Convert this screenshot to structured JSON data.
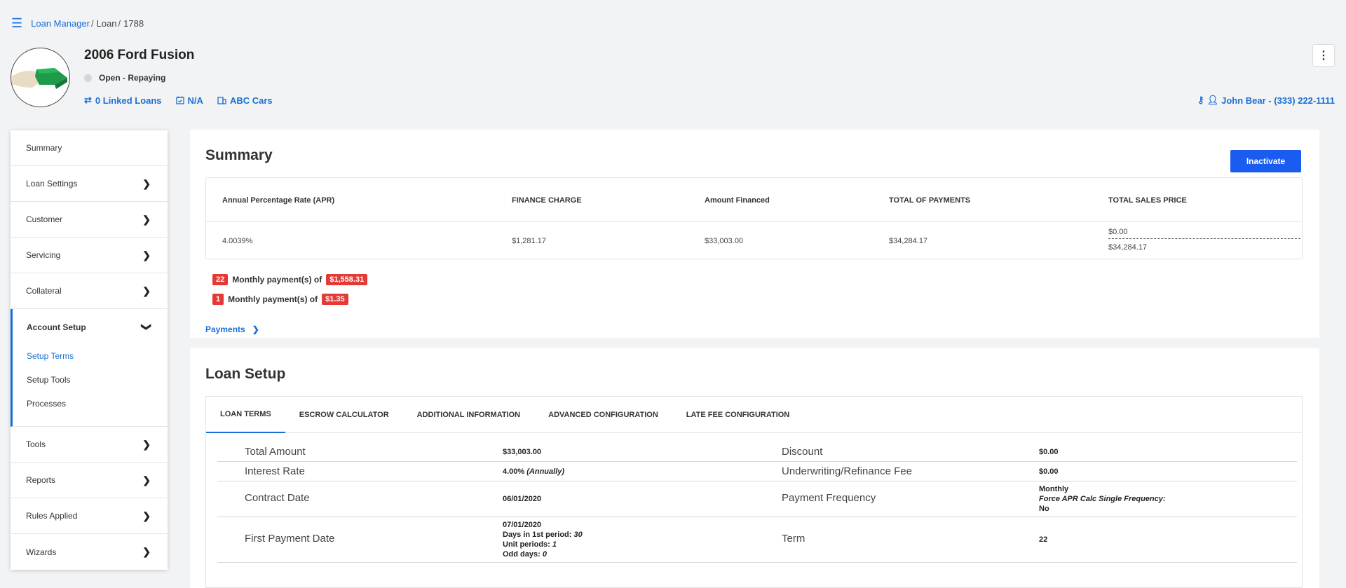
{
  "breadcrumb": {
    "root": "Loan Manager",
    "section": "Loan",
    "id": "1788"
  },
  "header": {
    "title": "2006 Ford Fusion",
    "status": "Open - Repaying",
    "linked_loans": "0 Linked Loans",
    "date": "N/A",
    "dealer": "ABC Cars",
    "contact": "John Bear - (333) 222-1111"
  },
  "sidebar": {
    "items": [
      {
        "label": "Summary"
      },
      {
        "label": "Loan Settings"
      },
      {
        "label": "Customer"
      },
      {
        "label": "Servicing"
      },
      {
        "label": "Collateral"
      }
    ],
    "group": {
      "label": "Account Setup",
      "subitems": [
        "Setup Terms",
        "Setup Tools",
        "Processes"
      ]
    },
    "items_after": [
      {
        "label": "Tools"
      },
      {
        "label": "Reports"
      },
      {
        "label": "Rules Applied"
      },
      {
        "label": "Wizards"
      }
    ]
  },
  "summary": {
    "title": "Summary",
    "inactivate_label": "Inactivate",
    "headers": [
      "Annual Percentage Rate (APR)",
      "FINANCE CHARGE",
      "Amount Financed",
      "TOTAL OF PAYMENTS",
      "TOTAL SALES PRICE"
    ],
    "values": [
      "4.0039%",
      "$1,281.17",
      "$33,003.00",
      "$34,284.17"
    ],
    "sales_price_top": "$0.00",
    "sales_price_bottom": "$34,284.17",
    "payment_lines": [
      {
        "count": "22",
        "text": "Monthly payment(s) of",
        "amount": "$1,558.31"
      },
      {
        "count": "1",
        "text": "Monthly payment(s) of",
        "amount": "$1.35"
      }
    ],
    "payments_link": "Payments"
  },
  "loan_setup": {
    "title": "Loan Setup",
    "tabs": [
      "LOAN TERMS",
      "ESCROW CALCULATOR",
      "ADDITIONAL INFORMATION",
      "ADVANCED CONFIGURATION",
      "LATE FEE CONFIGURATION"
    ],
    "rows": {
      "total_amount_label": "Total Amount",
      "total_amount": "$33,003.00",
      "discount_label": "Discount",
      "discount": "$0.00",
      "interest_rate_label": "Interest Rate",
      "interest_rate": "4.00%",
      "interest_rate_period": "(Annually)",
      "fee_label": "Underwriting/Refinance Fee",
      "fee": "$0.00",
      "contract_date_label": "Contract Date",
      "contract_date": "06/01/2020",
      "payment_frequency_label": "Payment Frequency",
      "payment_frequency": "Monthly",
      "force_apr_label": "Force APR Calc Single Frequency:",
      "force_apr": "No",
      "first_payment_label": "First Payment Date",
      "first_payment_date": "07/01/2020",
      "days_first_period_label": "Days in 1st period:",
      "days_first_period": "30",
      "unit_periods_label": "Unit periods:",
      "unit_periods": "1",
      "odd_days_label": "Odd days:",
      "odd_days": "0",
      "term_label": "Term",
      "term": "22"
    }
  },
  "colors": {
    "accent": "#1a6fd6",
    "button": "#1a5cf0",
    "badge": "#e53935"
  }
}
